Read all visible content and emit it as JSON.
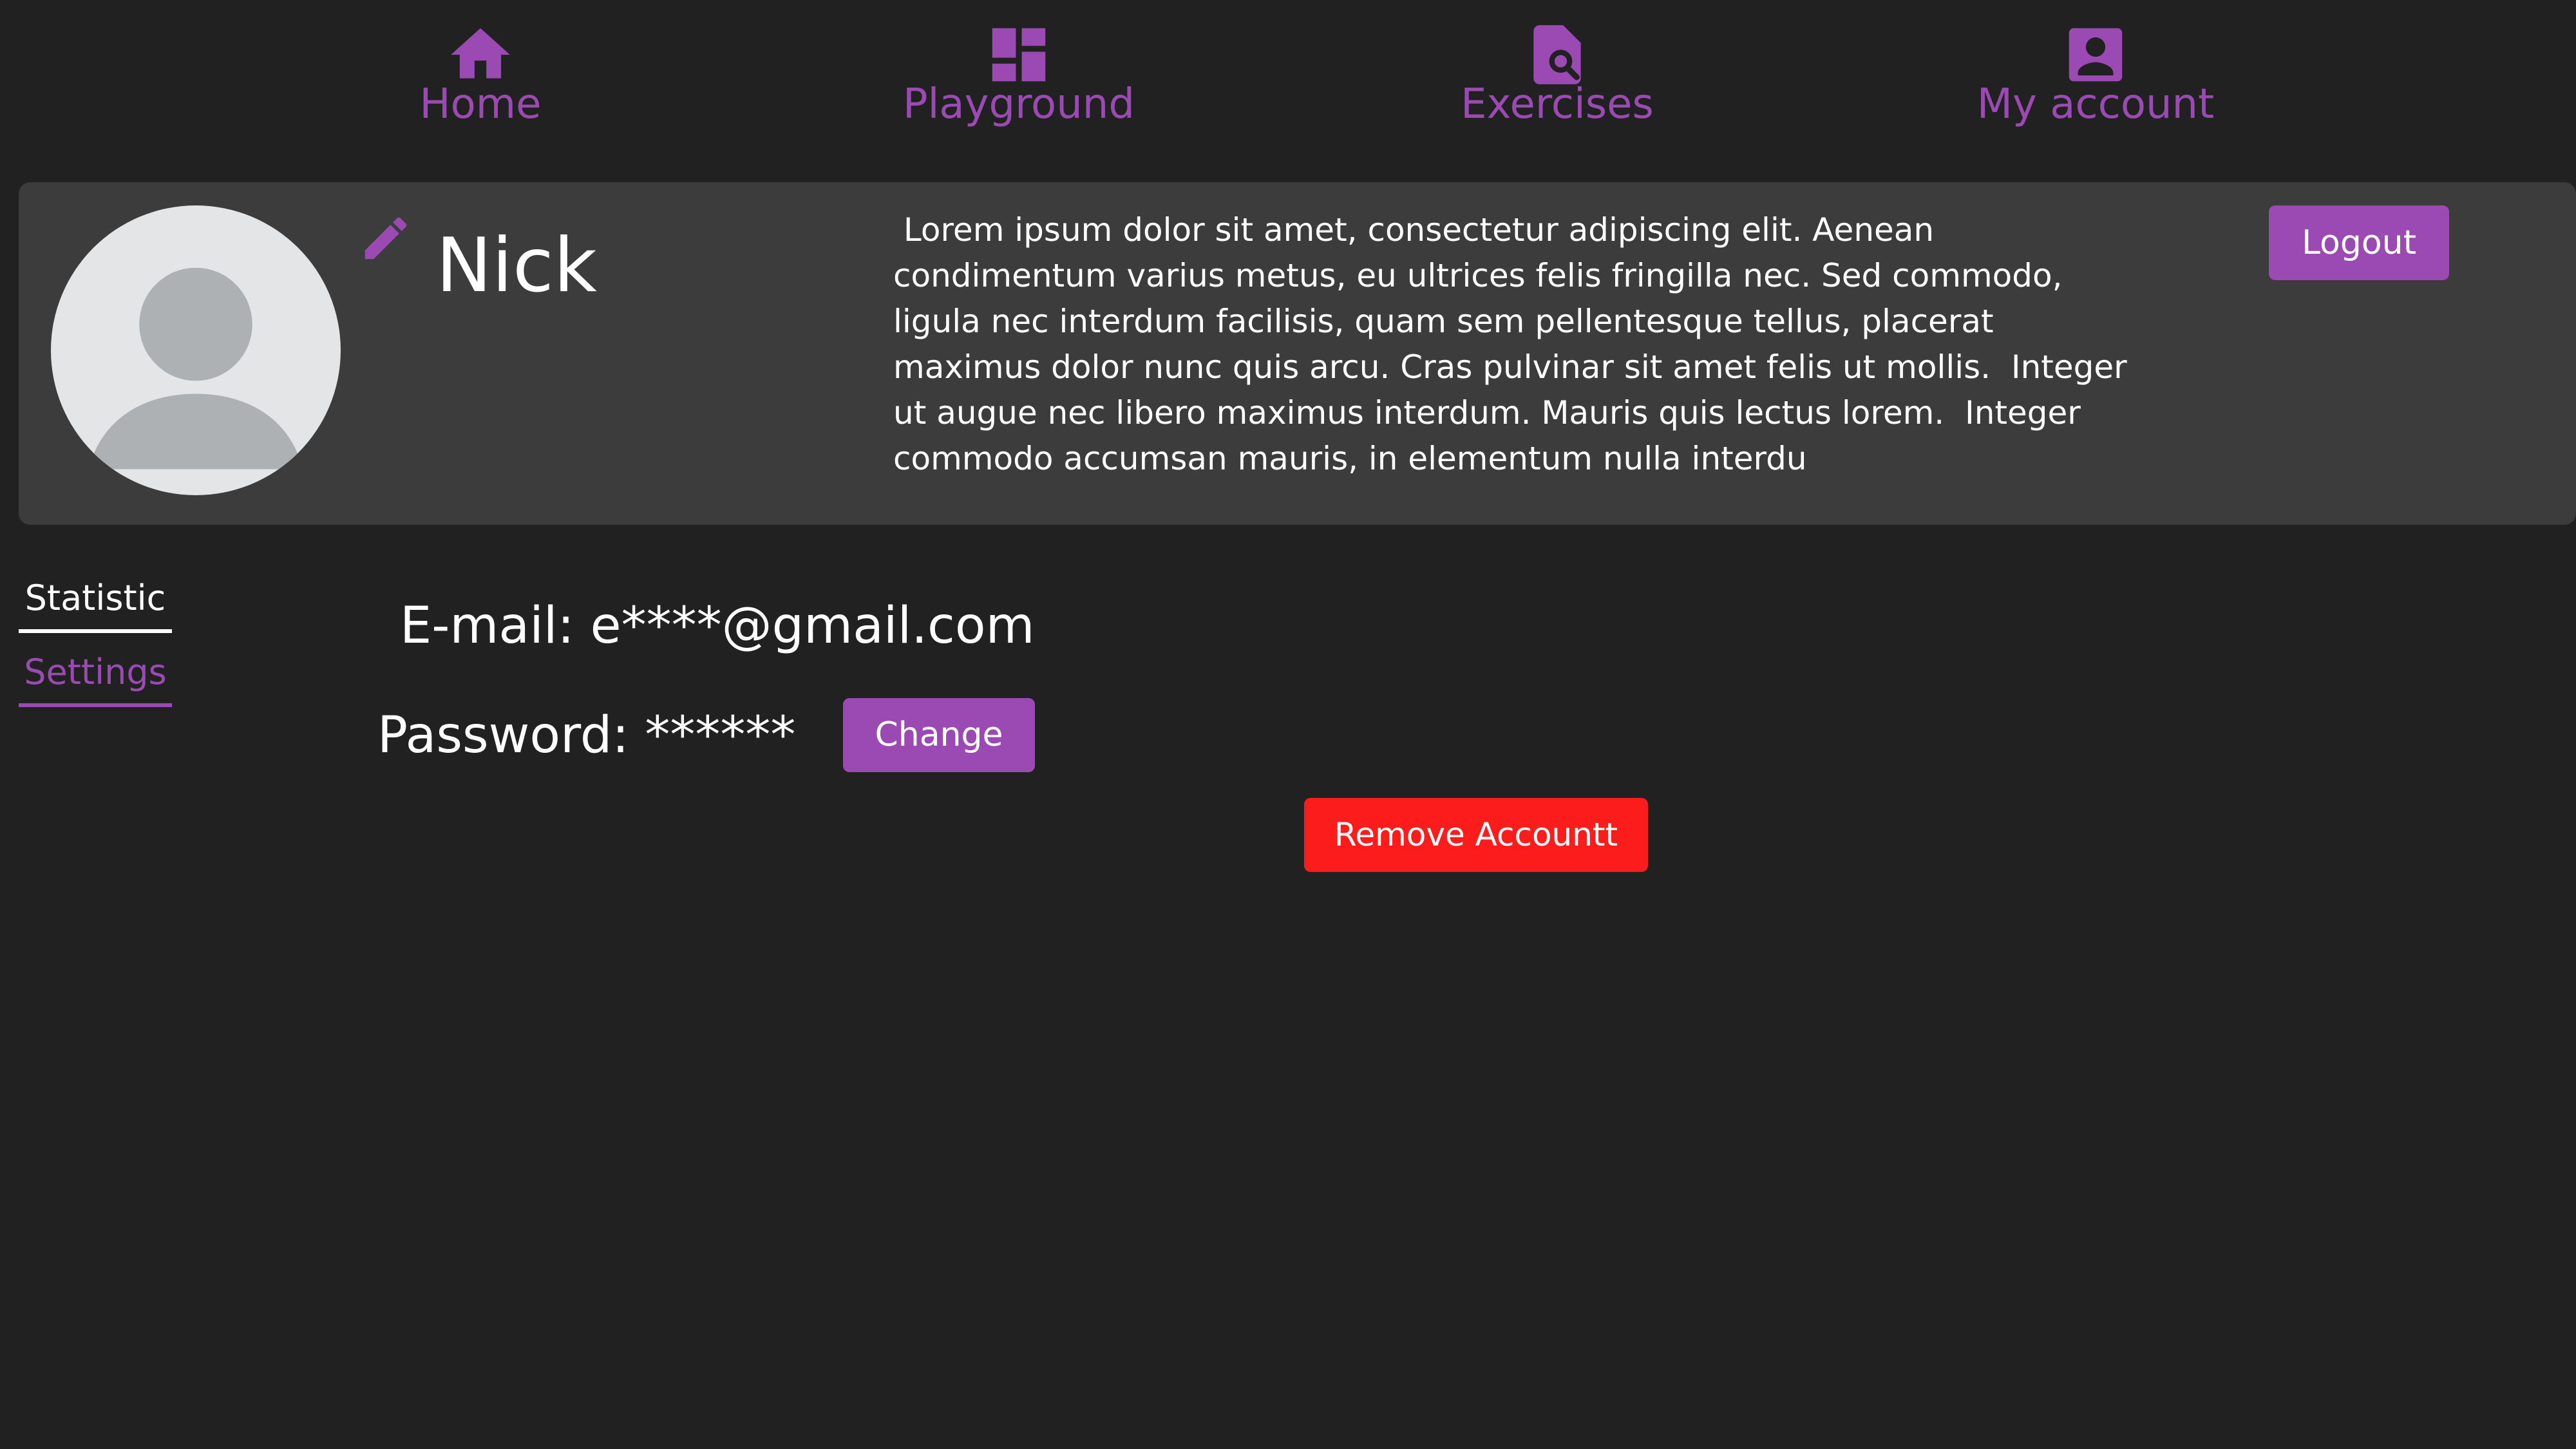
{
  "colors": {
    "background": "#212121",
    "card": "#3c3c3c",
    "accent": "#9b4ab4",
    "danger": "#fc1c1c",
    "avatar_bg": "#e3e5e7",
    "avatar_figure": "#adb1b4"
  },
  "nav": {
    "items": [
      {
        "label": "Home",
        "icon": "home-icon"
      },
      {
        "label": "Playground",
        "icon": "dashboard-icon"
      },
      {
        "label": "Exercises",
        "icon": "document-search-icon"
      },
      {
        "label": "My account",
        "icon": "account-box-icon"
      }
    ]
  },
  "profile": {
    "name": "Nick",
    "avatar_icon": "user-placeholder-icon",
    "edit_icon": "pencil-icon",
    "bio": " Lorem ipsum dolor sit amet, consectetur adipiscing elit. Aenean condimentum varius metus, eu ultrices felis fringilla nec. Sed commodo, ligula nec interdum facilisis, quam sem pellentesque tellus, placerat maximus dolor nunc quis arcu. Cras pulvinar sit amet felis ut mollis.  Integer ut augue nec libero maximus interdum. Mauris quis lectus lorem.  Integer commodo accumsan mauris, in elementum nulla interdu",
    "logout_label": "Logout"
  },
  "tabs": [
    {
      "label": "Statistic",
      "active": false
    },
    {
      "label": "Settings",
      "active": true
    }
  ],
  "settings": {
    "email_text": "E-mail: e****@gmail.com",
    "password_text": "Password: ******",
    "change_label": "Change",
    "remove_label": "Remove Accountt"
  }
}
